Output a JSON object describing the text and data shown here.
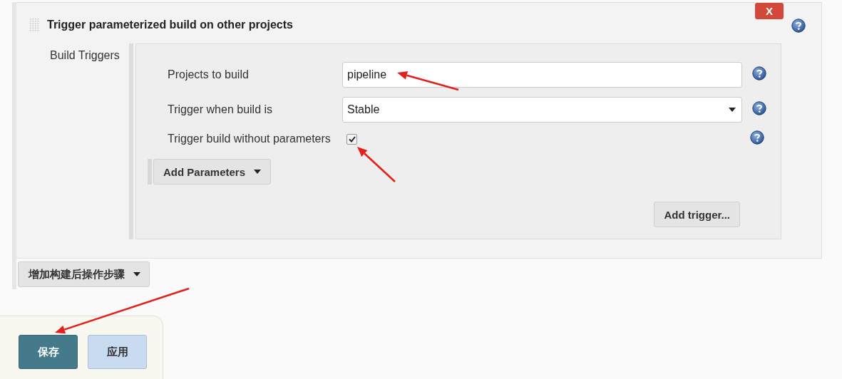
{
  "section": {
    "title": "Trigger parameterized build on other projects",
    "remove_button": "X",
    "field_label": "Build Triggers",
    "fields": [
      {
        "kind": "text",
        "label": "Projects to build",
        "value": "pipeline"
      },
      {
        "kind": "select",
        "label": "Trigger when build is",
        "value": "Stable"
      },
      {
        "kind": "checkbox",
        "label": "Trigger build without parameters",
        "checked": true
      }
    ],
    "add_parameters_button": "Add Parameters",
    "add_trigger_button": "Add trigger..."
  },
  "post_build_button": "增加构建后操作步骤",
  "footer": {
    "buttons": [
      {
        "label": "保存",
        "kind": "primary"
      },
      {
        "label": "应用",
        "kind": "secondary"
      }
    ]
  }
}
